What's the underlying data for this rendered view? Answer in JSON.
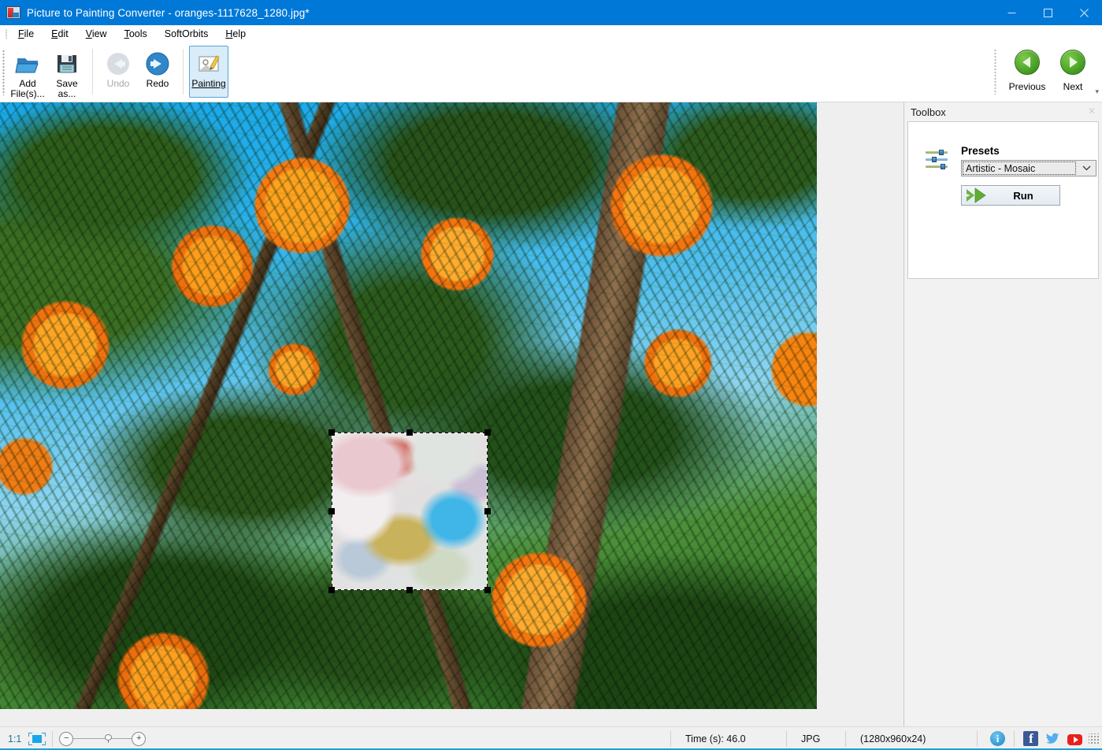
{
  "window": {
    "app_name": "Picture to Painting Converter",
    "document_name": "oranges-1117628_1280.jpg*",
    "title": "Picture to Painting Converter - oranges-1117628_1280.jpg*",
    "icon": "app-icon",
    "controls": {
      "minimize": "minimize-icon",
      "maximize": "maximize-icon",
      "close": "close-icon"
    },
    "titlebar_color": "#0078d7"
  },
  "menubar": {
    "items": [
      {
        "label": "File",
        "accel": "F"
      },
      {
        "label": "Edit",
        "accel": "E"
      },
      {
        "label": "View",
        "accel": "V"
      },
      {
        "label": "Tools",
        "accel": "T"
      },
      {
        "label": "SoftOrbits",
        "accel": ""
      },
      {
        "label": "Help",
        "accel": "H"
      }
    ]
  },
  "toolbar": {
    "add_files": {
      "label": "Add\nFile(s)...",
      "icon": "open-folder-icon",
      "enabled": true
    },
    "save_as": {
      "label": "Save\nas...",
      "icon": "floppy-disk-icon",
      "enabled": true
    },
    "undo": {
      "label": "Undo",
      "icon": "undo-arrow-icon",
      "enabled": false
    },
    "redo": {
      "label": "Redo",
      "icon": "redo-arrow-icon",
      "enabled": true
    },
    "painting": {
      "label": "Painting",
      "icon": "painting-brush-icon",
      "enabled": true,
      "selected": true
    },
    "overflow_icon": "toolbar-overflow-icon",
    "navigation": {
      "previous": {
        "label": "Previous",
        "icon": "arrow-left-circle-icon"
      },
      "next": {
        "label": "Next",
        "icon": "arrow-right-circle-icon"
      }
    }
  },
  "canvas": {
    "image_alt": "oranges on a tree with blue sky",
    "selection": {
      "name": "painting-preview-selection",
      "handles": 8,
      "style": "mosaic-stained-glass-preview"
    }
  },
  "toolbox": {
    "header": "Toolbox",
    "close_icon": "panel-close-icon",
    "presets_icon": "sliders-icon",
    "presets_label": "Presets",
    "preset_selected": "Artistic - Mosaic",
    "preset_dropdown_icon": "chevron-down-icon",
    "run_label": "Run",
    "run_icon": "green-double-arrow-icon"
  },
  "statusbar": {
    "zoom_ratio": "1:1",
    "fit_icon": "fit-to-window-icon",
    "zoom_out_icon": "minus-icon",
    "zoom_in_icon": "plus-icon",
    "time": "Time (s): 46.0",
    "format": "JPG",
    "dimensions": "(1280x960x24)",
    "social": {
      "info": "info-icon",
      "facebook": "facebook-icon",
      "twitter": "twitter-icon",
      "youtube": "youtube-icon"
    },
    "resize_grip": "resize-grip-icon",
    "accent_color": "#1d9fd8"
  }
}
